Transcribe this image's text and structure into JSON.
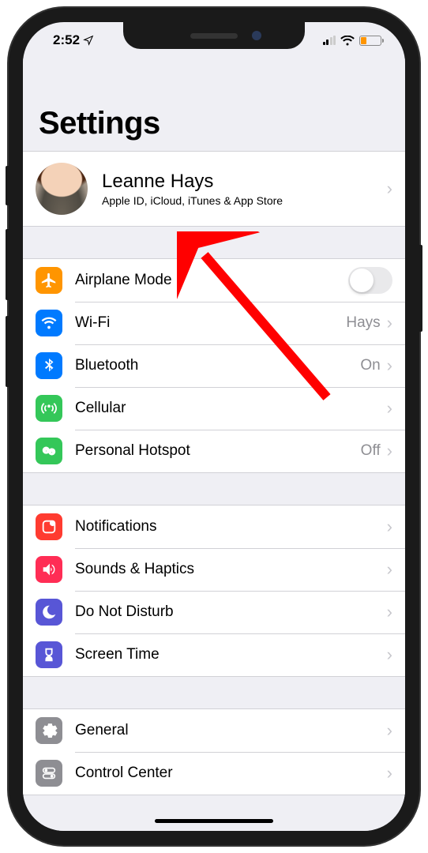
{
  "status": {
    "time": "2:52",
    "location_active": true
  },
  "page": {
    "title": "Settings"
  },
  "apple_id": {
    "name": "Leanne Hays",
    "subtitle": "Apple ID, iCloud, iTunes & App Store"
  },
  "groups": [
    {
      "rows": [
        {
          "id": "airplane",
          "label": "Airplane Mode",
          "control": "toggle",
          "toggle_on": false,
          "color": "#ff9500"
        },
        {
          "id": "wifi",
          "label": "Wi-Fi",
          "detail": "Hays",
          "chevron": true,
          "color": "#007aff"
        },
        {
          "id": "bluetooth",
          "label": "Bluetooth",
          "detail": "On",
          "chevron": true,
          "color": "#007aff"
        },
        {
          "id": "cellular",
          "label": "Cellular",
          "chevron": true,
          "color": "#34c759"
        },
        {
          "id": "hotspot",
          "label": "Personal Hotspot",
          "detail": "Off",
          "chevron": true,
          "color": "#34c759"
        }
      ]
    },
    {
      "rows": [
        {
          "id": "notifications",
          "label": "Notifications",
          "chevron": true,
          "color": "#ff3b30"
        },
        {
          "id": "sounds",
          "label": "Sounds & Haptics",
          "chevron": true,
          "color": "#ff2d55"
        },
        {
          "id": "dnd",
          "label": "Do Not Disturb",
          "chevron": true,
          "color": "#5856d6"
        },
        {
          "id": "screentime",
          "label": "Screen Time",
          "chevron": true,
          "color": "#5856d6"
        }
      ]
    },
    {
      "rows": [
        {
          "id": "general",
          "label": "General",
          "chevron": true,
          "color": "#8e8e93"
        },
        {
          "id": "controlcenter",
          "label": "Control Center",
          "chevron": true,
          "color": "#8e8e93"
        }
      ]
    }
  ]
}
